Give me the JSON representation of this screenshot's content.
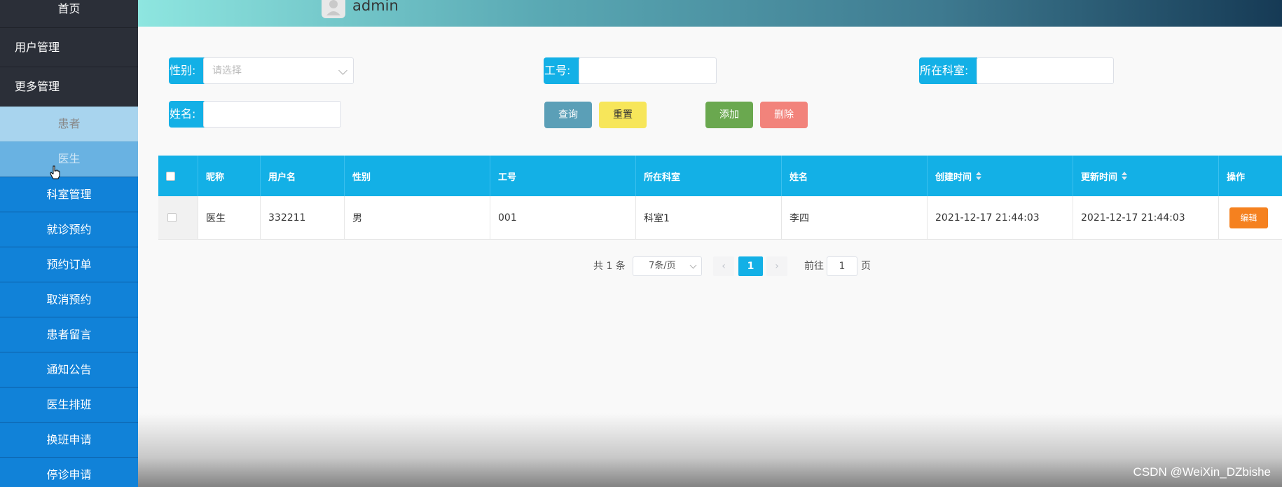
{
  "sidebar": {
    "home": "首页",
    "user_mgmt": "用户管理",
    "more_mgmt": "更多管理",
    "sub_patient": "患者",
    "sub_doctor": "医生",
    "items": [
      "科室管理",
      "就诊预约",
      "预约订单",
      "取消预约",
      "患者留言",
      "通知公告",
      "医生排班",
      "换班申请",
      "停诊申请"
    ]
  },
  "header": {
    "username": "admin"
  },
  "filters": {
    "gender_label": "性别:",
    "gender_placeholder": "请选择",
    "jobno_label": "工号:",
    "dept_label": "所在科室:",
    "name_label": "姓名:"
  },
  "buttons": {
    "query": "查询",
    "reset": "重置",
    "add": "添加",
    "delete": "删除",
    "edit": "编辑"
  },
  "colors": {
    "primary": "#13b0e6",
    "query": "#5b9fb7",
    "reset": "#f7e65a",
    "add": "#6aa84f",
    "delete": "#f2837b",
    "edit": "#f5811f"
  },
  "table": {
    "headers": [
      "昵称",
      "用户名",
      "性别",
      "工号",
      "所在科室",
      "姓名",
      "创建时间",
      "更新时间",
      "操作"
    ],
    "rows": [
      [
        "医生",
        "332211",
        "男",
        "001",
        "科室1",
        "李四",
        "2021-12-17 21:44:03",
        "2021-12-17 21:44:03"
      ]
    ]
  },
  "pager": {
    "total": "共 1 条",
    "page_size": "7条/页",
    "current": "1",
    "goto_label": "前往",
    "goto_value": "1",
    "page_suffix": "页"
  },
  "watermark": "CSDN @WeiXin_DZbishe"
}
